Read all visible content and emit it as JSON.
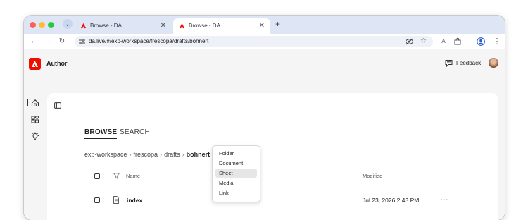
{
  "browser": {
    "tabs": [
      {
        "title": "Browse - DA",
        "active": false
      },
      {
        "title": "Browse - DA",
        "active": true
      }
    ],
    "url": "da.live/#/exp-workspace/frescopa/drafts/bohnert",
    "profile_initial": "A"
  },
  "app": {
    "title": "Author",
    "feedback_label": "Feedback",
    "brand_color": "#eb1000"
  },
  "nav": {
    "browse": "BROWSE",
    "search": "SEARCH"
  },
  "breadcrumb": {
    "items": [
      "exp-workspace",
      "frescopa",
      "drafts"
    ],
    "current": "bohnert",
    "separator": "›"
  },
  "table": {
    "headers": {
      "name": "Name",
      "modified": "Modified"
    },
    "rows": [
      {
        "name": "index",
        "modified": "Jul 23, 2026 2:43 PM",
        "more": "···"
      }
    ]
  },
  "add_menu": {
    "items": [
      "Folder",
      "Document",
      "Sheet",
      "Media",
      "Link"
    ],
    "highlighted": "Sheet"
  }
}
